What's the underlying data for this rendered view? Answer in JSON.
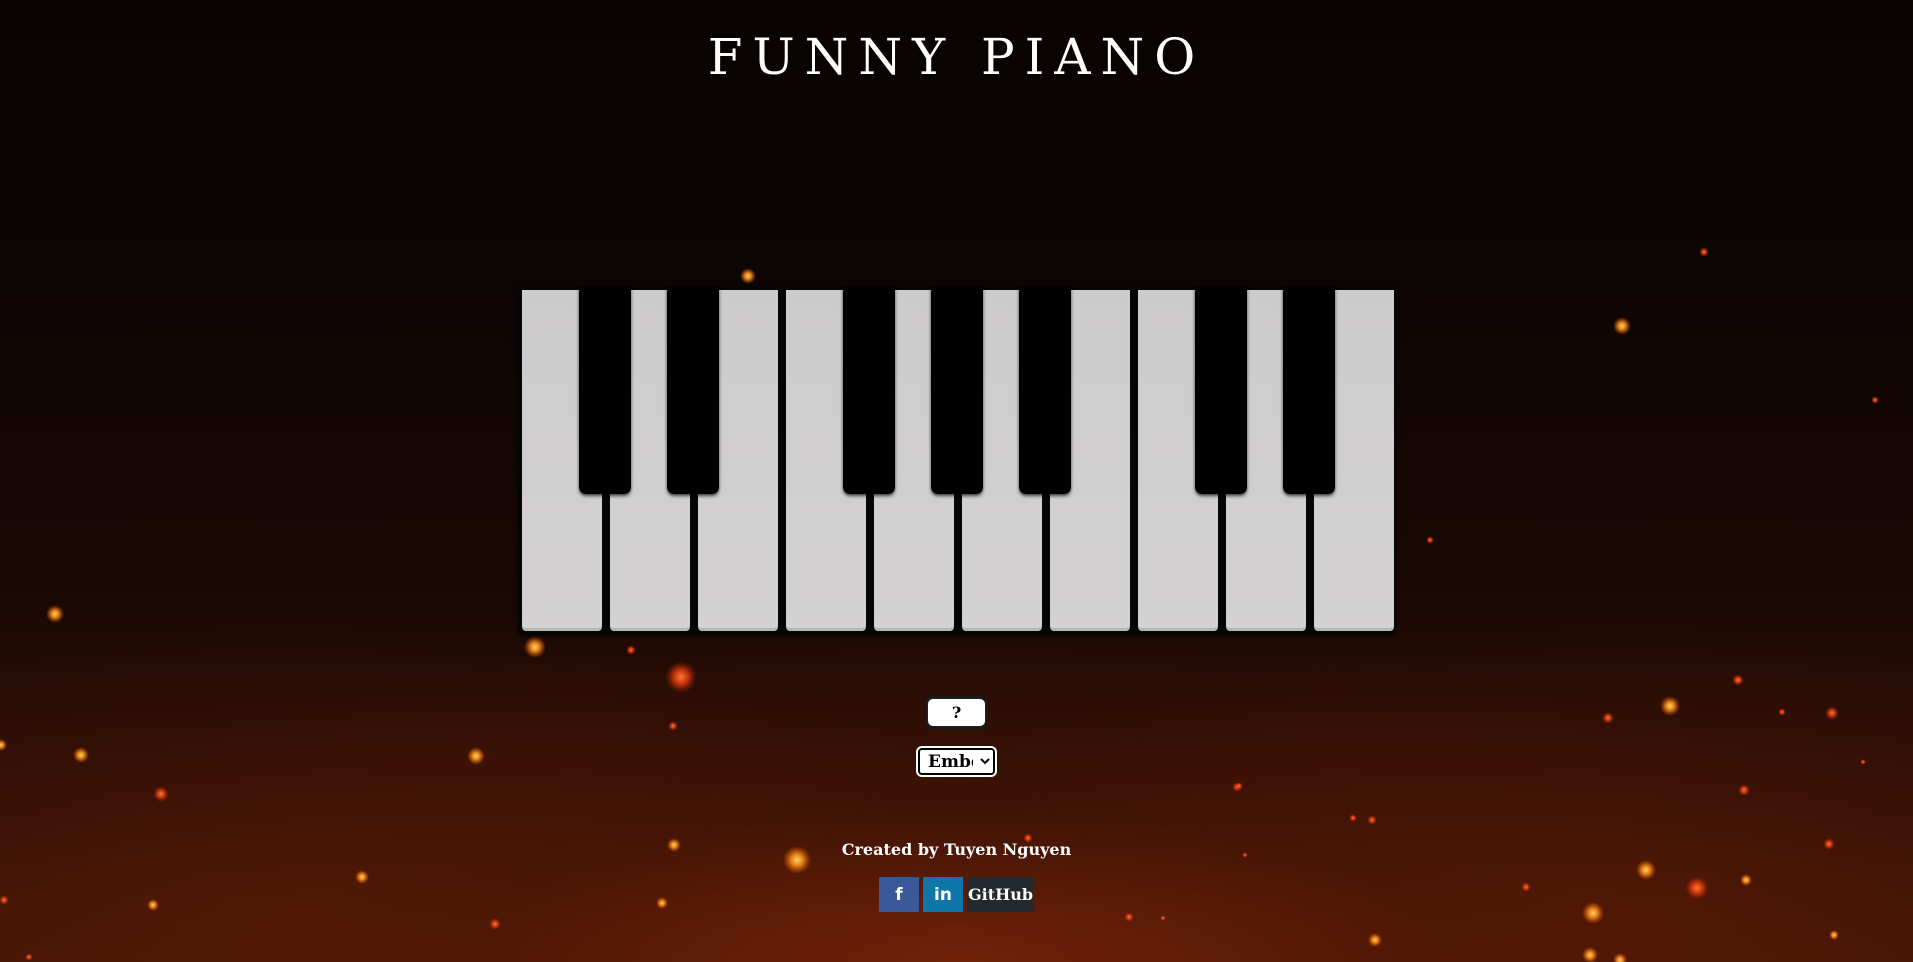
{
  "header": {
    "title": "FUNNY PIANO"
  },
  "piano": {
    "white_keys": [
      "",
      "",
      "",
      "",
      "",
      "",
      "",
      "",
      "",
      ""
    ],
    "black_keys": [
      "",
      "",
      "",
      "",
      "",
      "",
      ""
    ]
  },
  "controls": {
    "help_label": "?",
    "theme_selected": "Ember",
    "theme_options": [
      "Ember"
    ]
  },
  "footer": {
    "credit": "Created by Tuyen Nguyen",
    "facebook_label": "f",
    "linkedin_label": "in",
    "github_label": "GitHub"
  },
  "colors": {
    "white_key": "#cfcdcd",
    "black_key": "#000000",
    "facebook": "#3b5998",
    "linkedin": "#0e76a8",
    "github": "#24292e"
  }
}
